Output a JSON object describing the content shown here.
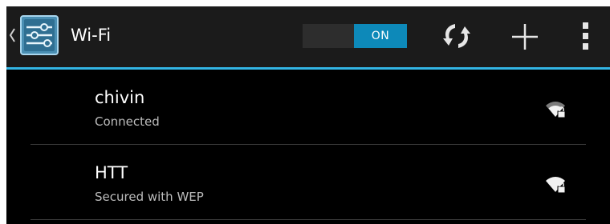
{
  "actionbar": {
    "title": "Wi-Fi",
    "app_icon": "settings-sliders-icon",
    "toggle_state": "ON",
    "actions": [
      {
        "icon": "wps-scan-icon"
      },
      {
        "icon": "add-icon"
      },
      {
        "icon": "overflow-menu-icon"
      }
    ]
  },
  "networks": [
    {
      "name": "chivin",
      "status": "Connected",
      "icon": "wifi-signal-locked-icon"
    },
    {
      "name": "HTT",
      "status": "Secured with WEP",
      "icon": "wifi-signal-locked-icon"
    }
  ],
  "colors": {
    "accent": "#33b5e5",
    "toggle_on": "#0d89b9",
    "background": "#000000",
    "actionbar": "#1b1b1b"
  }
}
